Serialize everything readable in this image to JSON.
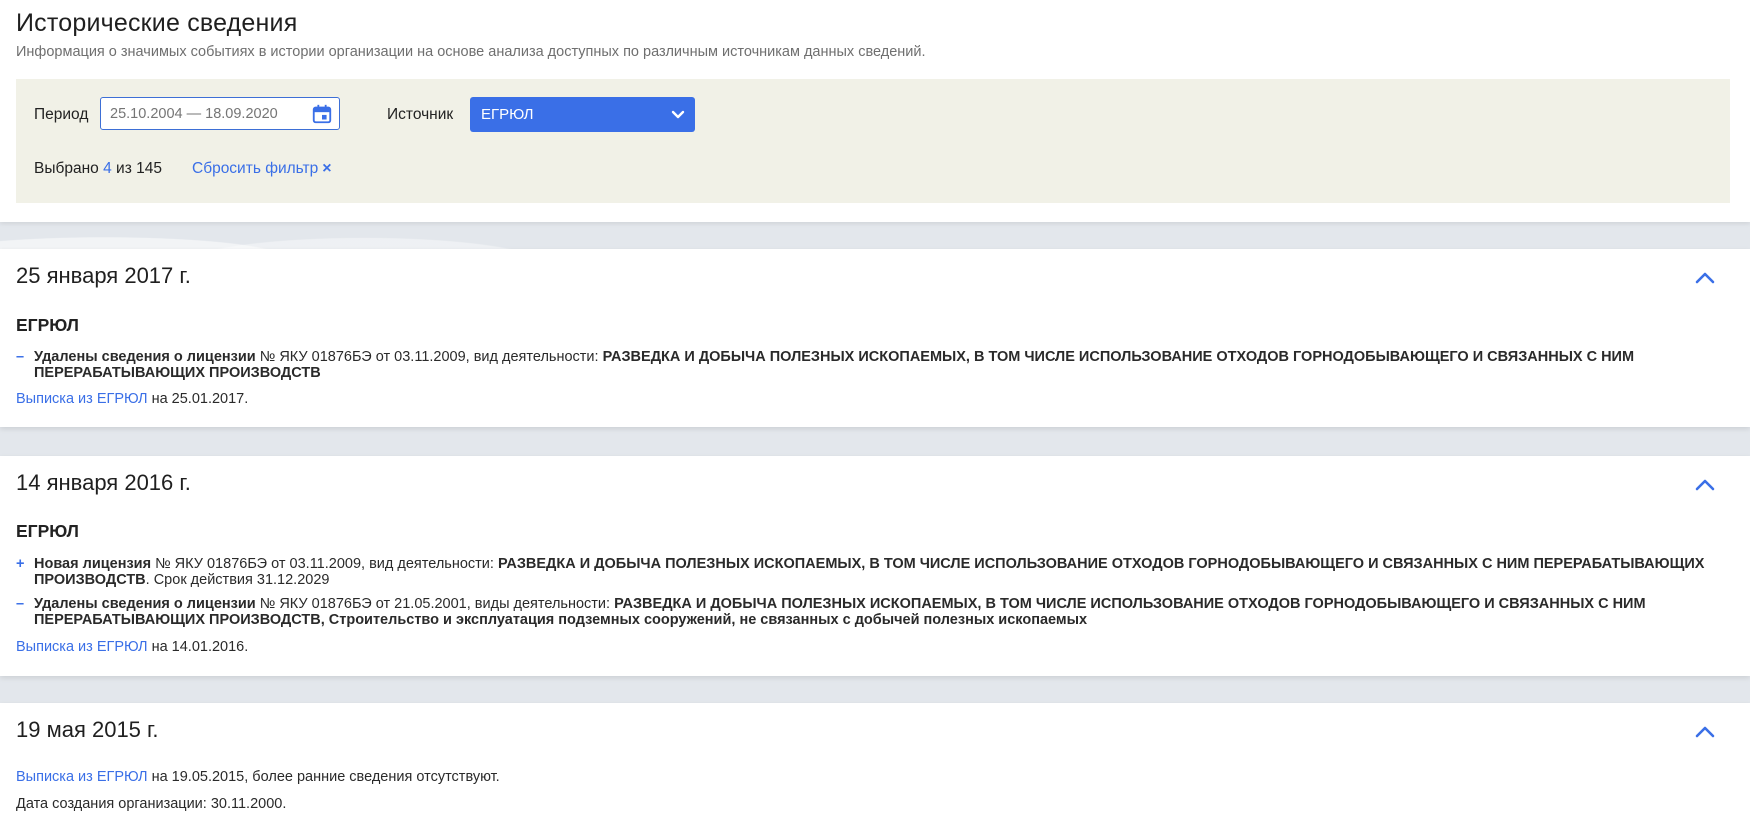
{
  "header": {
    "title": "Исторические сведения",
    "subtitle": "Информация о значимых событиях в истории организации на основе анализа доступных по различным источникам данных сведений."
  },
  "filter": {
    "period_label": "Период",
    "period_placeholder": "25.10.2004 — 18.09.2020",
    "source_label": "Источник",
    "source_value": "ЕГРЮЛ",
    "selected_prefix": "Выбрано",
    "selected_count": "4",
    "selected_of": "из 145",
    "reset_label": "Сбросить фильтр",
    "reset_icon": "×"
  },
  "events": [
    {
      "date": "25 января 2017 г.",
      "source": "ЕГРЮЛ",
      "changes": [
        {
          "sign": "–",
          "lead": "Удалены сведения о лицензии",
          "middle": " № ЯКУ 01876БЭ от 03.11.2009, вид деятельности: ",
          "activity": "РАЗВЕДКА И ДОБЫЧА ПОЛЕЗНЫХ ИСКОПАЕМЫХ, В ТОМ ЧИСЛЕ ИСПОЛЬЗОВАНИЕ ОТХОДОВ ГОРНОДОБЫВАЮЩЕГО И СВЯЗАННЫХ С НИМ ПЕРЕРАБАТЫВАЮЩИХ ПРОИЗВОДСТВ",
          "tail": ""
        }
      ],
      "extract_link": "Выписка из ЕГРЮЛ",
      "extract_suffix": " на 25.01.2017."
    },
    {
      "date": "14 января 2016 г.",
      "source": "ЕГРЮЛ",
      "changes": [
        {
          "sign": "+",
          "lead": "Новая лицензия",
          "middle": " № ЯКУ 01876БЭ от 03.11.2009, вид деятельности: ",
          "activity": "РАЗВЕДКА И ДОБЫЧА ПОЛЕЗНЫХ ИСКОПАЕМЫХ, В ТОМ ЧИСЛЕ ИСПОЛЬЗОВАНИЕ ОТХОДОВ ГОРНОДОБЫВАЮЩЕГО И СВЯЗАННЫХ С НИМ ПЕРЕРАБАТЫВАЮЩИХ ПРОИЗВОДСТВ",
          "tail": ". Срок действия 31.12.2029"
        },
        {
          "sign": "–",
          "lead": "Удалены сведения о лицензии",
          "middle": " № ЯКУ 01876БЭ от 21.05.2001, виды деятельности: ",
          "activity": "РАЗВЕДКА И ДОБЫЧА ПОЛЕЗНЫХ ИСКОПАЕМЫХ, В ТОМ ЧИСЛЕ ИСПОЛЬЗОВАНИЕ ОТХОДОВ ГОРНОДОБЫВАЮЩЕГО И СВЯЗАННЫХ С НИМ ПЕРЕРАБАТЫВАЮЩИХ ПРОИЗВОДСТВ, Строительство и эксплуатация подземных сооружений, не связанных с добычей полезных ископаемых",
          "tail": ""
        }
      ],
      "extract_link": "Выписка из ЕГРЮЛ",
      "extract_suffix": " на 14.01.2016."
    },
    {
      "date": "19 мая 2015 г.",
      "extract_link": "Выписка из ЕГРЮЛ",
      "extract_suffix": " на 19.05.2015, более ранние сведения отсутствуют.",
      "creation_text": "Дата создания организации: 30.11.2000."
    }
  ],
  "colors": {
    "accent": "#3a6fe7",
    "filter_bg": "#f1f1e7",
    "page_bg": "#e3e7ec"
  },
  "icons": {
    "calendar": "calendar-icon",
    "dropdown": "chevron-down-icon",
    "collapse": "chevron-up-icon",
    "reset": "close-icon"
  }
}
